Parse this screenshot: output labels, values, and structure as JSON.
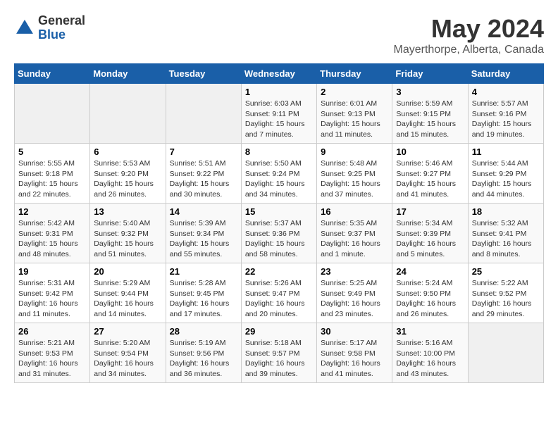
{
  "logo": {
    "general": "General",
    "blue": "Blue"
  },
  "title": "May 2024",
  "subtitle": "Mayerthorpe, Alberta, Canada",
  "days_of_week": [
    "Sunday",
    "Monday",
    "Tuesday",
    "Wednesday",
    "Thursday",
    "Friday",
    "Saturday"
  ],
  "weeks": [
    [
      {
        "day": "",
        "info": ""
      },
      {
        "day": "",
        "info": ""
      },
      {
        "day": "",
        "info": ""
      },
      {
        "day": "1",
        "info": "Sunrise: 6:03 AM\nSunset: 9:11 PM\nDaylight: 15 hours\nand 7 minutes."
      },
      {
        "day": "2",
        "info": "Sunrise: 6:01 AM\nSunset: 9:13 PM\nDaylight: 15 hours\nand 11 minutes."
      },
      {
        "day": "3",
        "info": "Sunrise: 5:59 AM\nSunset: 9:15 PM\nDaylight: 15 hours\nand 15 minutes."
      },
      {
        "day": "4",
        "info": "Sunrise: 5:57 AM\nSunset: 9:16 PM\nDaylight: 15 hours\nand 19 minutes."
      }
    ],
    [
      {
        "day": "5",
        "info": "Sunrise: 5:55 AM\nSunset: 9:18 PM\nDaylight: 15 hours\nand 22 minutes."
      },
      {
        "day": "6",
        "info": "Sunrise: 5:53 AM\nSunset: 9:20 PM\nDaylight: 15 hours\nand 26 minutes."
      },
      {
        "day": "7",
        "info": "Sunrise: 5:51 AM\nSunset: 9:22 PM\nDaylight: 15 hours\nand 30 minutes."
      },
      {
        "day": "8",
        "info": "Sunrise: 5:50 AM\nSunset: 9:24 PM\nDaylight: 15 hours\nand 34 minutes."
      },
      {
        "day": "9",
        "info": "Sunrise: 5:48 AM\nSunset: 9:25 PM\nDaylight: 15 hours\nand 37 minutes."
      },
      {
        "day": "10",
        "info": "Sunrise: 5:46 AM\nSunset: 9:27 PM\nDaylight: 15 hours\nand 41 minutes."
      },
      {
        "day": "11",
        "info": "Sunrise: 5:44 AM\nSunset: 9:29 PM\nDaylight: 15 hours\nand 44 minutes."
      }
    ],
    [
      {
        "day": "12",
        "info": "Sunrise: 5:42 AM\nSunset: 9:31 PM\nDaylight: 15 hours\nand 48 minutes."
      },
      {
        "day": "13",
        "info": "Sunrise: 5:40 AM\nSunset: 9:32 PM\nDaylight: 15 hours\nand 51 minutes."
      },
      {
        "day": "14",
        "info": "Sunrise: 5:39 AM\nSunset: 9:34 PM\nDaylight: 15 hours\nand 55 minutes."
      },
      {
        "day": "15",
        "info": "Sunrise: 5:37 AM\nSunset: 9:36 PM\nDaylight: 15 hours\nand 58 minutes."
      },
      {
        "day": "16",
        "info": "Sunrise: 5:35 AM\nSunset: 9:37 PM\nDaylight: 16 hours\nand 1 minute."
      },
      {
        "day": "17",
        "info": "Sunrise: 5:34 AM\nSunset: 9:39 PM\nDaylight: 16 hours\nand 5 minutes."
      },
      {
        "day": "18",
        "info": "Sunrise: 5:32 AM\nSunset: 9:41 PM\nDaylight: 16 hours\nand 8 minutes."
      }
    ],
    [
      {
        "day": "19",
        "info": "Sunrise: 5:31 AM\nSunset: 9:42 PM\nDaylight: 16 hours\nand 11 minutes."
      },
      {
        "day": "20",
        "info": "Sunrise: 5:29 AM\nSunset: 9:44 PM\nDaylight: 16 hours\nand 14 minutes."
      },
      {
        "day": "21",
        "info": "Sunrise: 5:28 AM\nSunset: 9:45 PM\nDaylight: 16 hours\nand 17 minutes."
      },
      {
        "day": "22",
        "info": "Sunrise: 5:26 AM\nSunset: 9:47 PM\nDaylight: 16 hours\nand 20 minutes."
      },
      {
        "day": "23",
        "info": "Sunrise: 5:25 AM\nSunset: 9:49 PM\nDaylight: 16 hours\nand 23 minutes."
      },
      {
        "day": "24",
        "info": "Sunrise: 5:24 AM\nSunset: 9:50 PM\nDaylight: 16 hours\nand 26 minutes."
      },
      {
        "day": "25",
        "info": "Sunrise: 5:22 AM\nSunset: 9:52 PM\nDaylight: 16 hours\nand 29 minutes."
      }
    ],
    [
      {
        "day": "26",
        "info": "Sunrise: 5:21 AM\nSunset: 9:53 PM\nDaylight: 16 hours\nand 31 minutes."
      },
      {
        "day": "27",
        "info": "Sunrise: 5:20 AM\nSunset: 9:54 PM\nDaylight: 16 hours\nand 34 minutes."
      },
      {
        "day": "28",
        "info": "Sunrise: 5:19 AM\nSunset: 9:56 PM\nDaylight: 16 hours\nand 36 minutes."
      },
      {
        "day": "29",
        "info": "Sunrise: 5:18 AM\nSunset: 9:57 PM\nDaylight: 16 hours\nand 39 minutes."
      },
      {
        "day": "30",
        "info": "Sunrise: 5:17 AM\nSunset: 9:58 PM\nDaylight: 16 hours\nand 41 minutes."
      },
      {
        "day": "31",
        "info": "Sunrise: 5:16 AM\nSunset: 10:00 PM\nDaylight: 16 hours\nand 43 minutes."
      },
      {
        "day": "",
        "info": ""
      }
    ]
  ]
}
